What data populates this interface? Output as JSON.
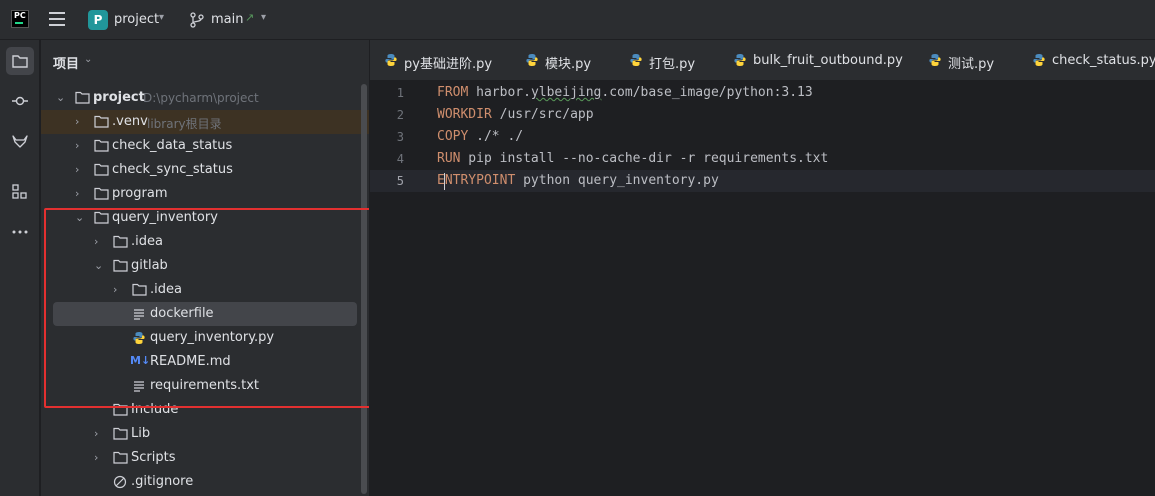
{
  "app": {
    "logo_text": "PC",
    "project_badge": "P",
    "project_name": "project",
    "branch": "main"
  },
  "panel": {
    "title": "项目"
  },
  "tree": {
    "root_label": "project",
    "root_path": "D:\\pycharm\\project",
    "venv_label": ".venv",
    "venv_hint": "library根目录",
    "check_data_status": "check_data_status",
    "check_sync_status": "check_sync_status",
    "program": "program",
    "query_inventory": "query_inventory",
    "idea": ".idea",
    "gitlab": "gitlab",
    "gitlab_idea": ".idea",
    "dockerfile": "dockerfile",
    "query_inventory_py": "query_inventory.py",
    "readme": "README.md",
    "requirements": "requirements.txt",
    "include": "Include",
    "lib": "Lib",
    "scripts": "Scripts",
    "gitignore": ".gitignore"
  },
  "tabs": [
    "py基础进阶.py",
    "模块.py",
    "打包.py",
    "bulk_fruit_outbound.py",
    "测试.py",
    "check_status.py"
  ],
  "editor": {
    "line_numbers": [
      "1",
      "2",
      "3",
      "4",
      "5"
    ],
    "lines": [
      {
        "kw": "FROM",
        "pre": " harbor.",
        "squig": "ylbeijing",
        "rest": ".com/base_image/python:3.13"
      },
      {
        "kw": "WORKDIR",
        "rest": " /usr/src/app"
      },
      {
        "kw": "COPY",
        "rest": " ./* ./"
      },
      {
        "kw": "RUN",
        "rest": " pip install --no-cache-dir -r requirements.txt"
      },
      {
        "kw": "ENTRYPOINT",
        "rest": " python query_inventory.py"
      }
    ],
    "current_line": 5
  },
  "colors": {
    "accent_green": "#21d789",
    "project_badge": "#21969a",
    "annotation_red": "#e33030",
    "keyword": "#cf8e6d"
  }
}
